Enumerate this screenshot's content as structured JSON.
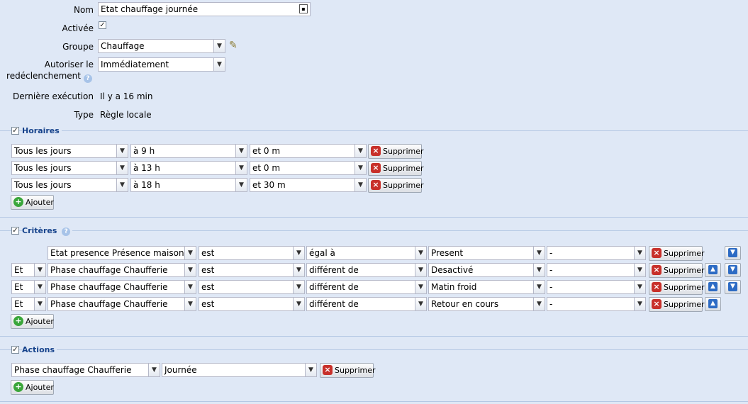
{
  "form": {
    "nom_label": "Nom",
    "nom_value": "Etat chauffage journée",
    "activee_label": "Activée",
    "groupe_label": "Groupe",
    "groupe_value": "Chauffage",
    "autoriser_label_1": "Autoriser le",
    "autoriser_label_2": "redéclenchement",
    "autoriser_value": "Immédiatement",
    "derniere_label": "Dernière exécution",
    "derniere_value": "Il y a 16 min",
    "type_label": "Type",
    "type_value": "Règle locale"
  },
  "horaires": {
    "title": "Horaires",
    "rows": [
      {
        "jour": "Tous les jours",
        "heure": "à 9 h",
        "minute": "et 0 m"
      },
      {
        "jour": "Tous les jours",
        "heure": "à 13 h",
        "minute": "et 0 m"
      },
      {
        "jour": "Tous les jours",
        "heure": "à 18 h",
        "minute": "et 30 m"
      }
    ]
  },
  "criteres": {
    "title": "Critères",
    "rows": [
      {
        "conj": "",
        "device": "Etat presence Présence maison",
        "verb": "est",
        "op": "égal à",
        "value": "Present",
        "extra": "-"
      },
      {
        "conj": "Et",
        "device": "Phase chauffage Chaufferie",
        "verb": "est",
        "op": "différent de",
        "value": "Desactivé",
        "extra": "-"
      },
      {
        "conj": "Et",
        "device": "Phase chauffage Chaufferie",
        "verb": "est",
        "op": "différent de",
        "value": "Matin froid",
        "extra": "-"
      },
      {
        "conj": "Et",
        "device": "Phase chauffage Chaufferie",
        "verb": "est",
        "op": "différent de",
        "value": "Retour en cours",
        "extra": "-"
      }
    ]
  },
  "actions": {
    "title": "Actions",
    "rows": [
      {
        "device": "Phase chauffage Chaufferie",
        "value": "Journée"
      }
    ]
  },
  "buttons": {
    "supprimer": "Supprimer",
    "ajouter": "Ajouter"
  },
  "icons": {
    "dropdown": "chevron-down-icon",
    "delete": "delete-icon",
    "add": "add-icon",
    "edit": "pencil-icon",
    "help": "help-icon",
    "up": "arrow-up-icon",
    "down": "arrow-down-icon",
    "contact": "contact-card-icon"
  }
}
